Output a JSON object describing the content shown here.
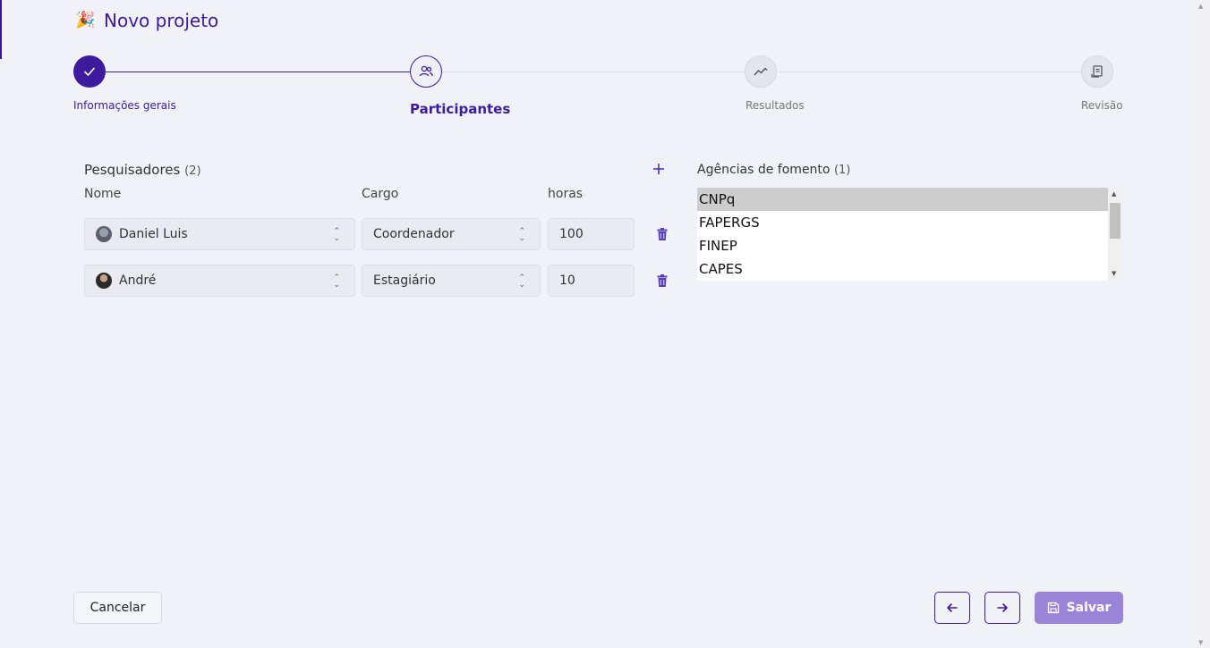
{
  "page": {
    "title": "Novo projeto",
    "title_icon": "party-popper-icon"
  },
  "stepper": {
    "steps": [
      {
        "label": "Informações gerais",
        "state": "done",
        "icon": "check-icon"
      },
      {
        "label": "Participantes",
        "state": "active",
        "icon": "people-icon"
      },
      {
        "label": "Resultados",
        "state": "pending",
        "icon": "trend-icon"
      },
      {
        "label": "Revisão",
        "state": "pending",
        "icon": "document-icon"
      }
    ]
  },
  "researchers": {
    "title": "Pesquisadores",
    "count": "(2)",
    "columns": {
      "name": "Nome",
      "role": "Cargo",
      "hours": "horas"
    },
    "rows": [
      {
        "name": "Daniel Luis",
        "role": "Coordenador",
        "hours": "100"
      },
      {
        "name": "André",
        "role": "Estagiário",
        "hours": "10"
      }
    ]
  },
  "agencies": {
    "title": "Agências de fomento",
    "count": "(1)",
    "options": [
      "CNPq",
      "FAPERGS",
      "FINEP",
      "CAPES"
    ],
    "selected": "CNPq"
  },
  "footer": {
    "cancel_label": "Cancelar",
    "save_label": "Salvar"
  },
  "colors": {
    "accent": "#3d1a9e",
    "save_button": "#9a84d8",
    "background": "#f0f2f8"
  }
}
